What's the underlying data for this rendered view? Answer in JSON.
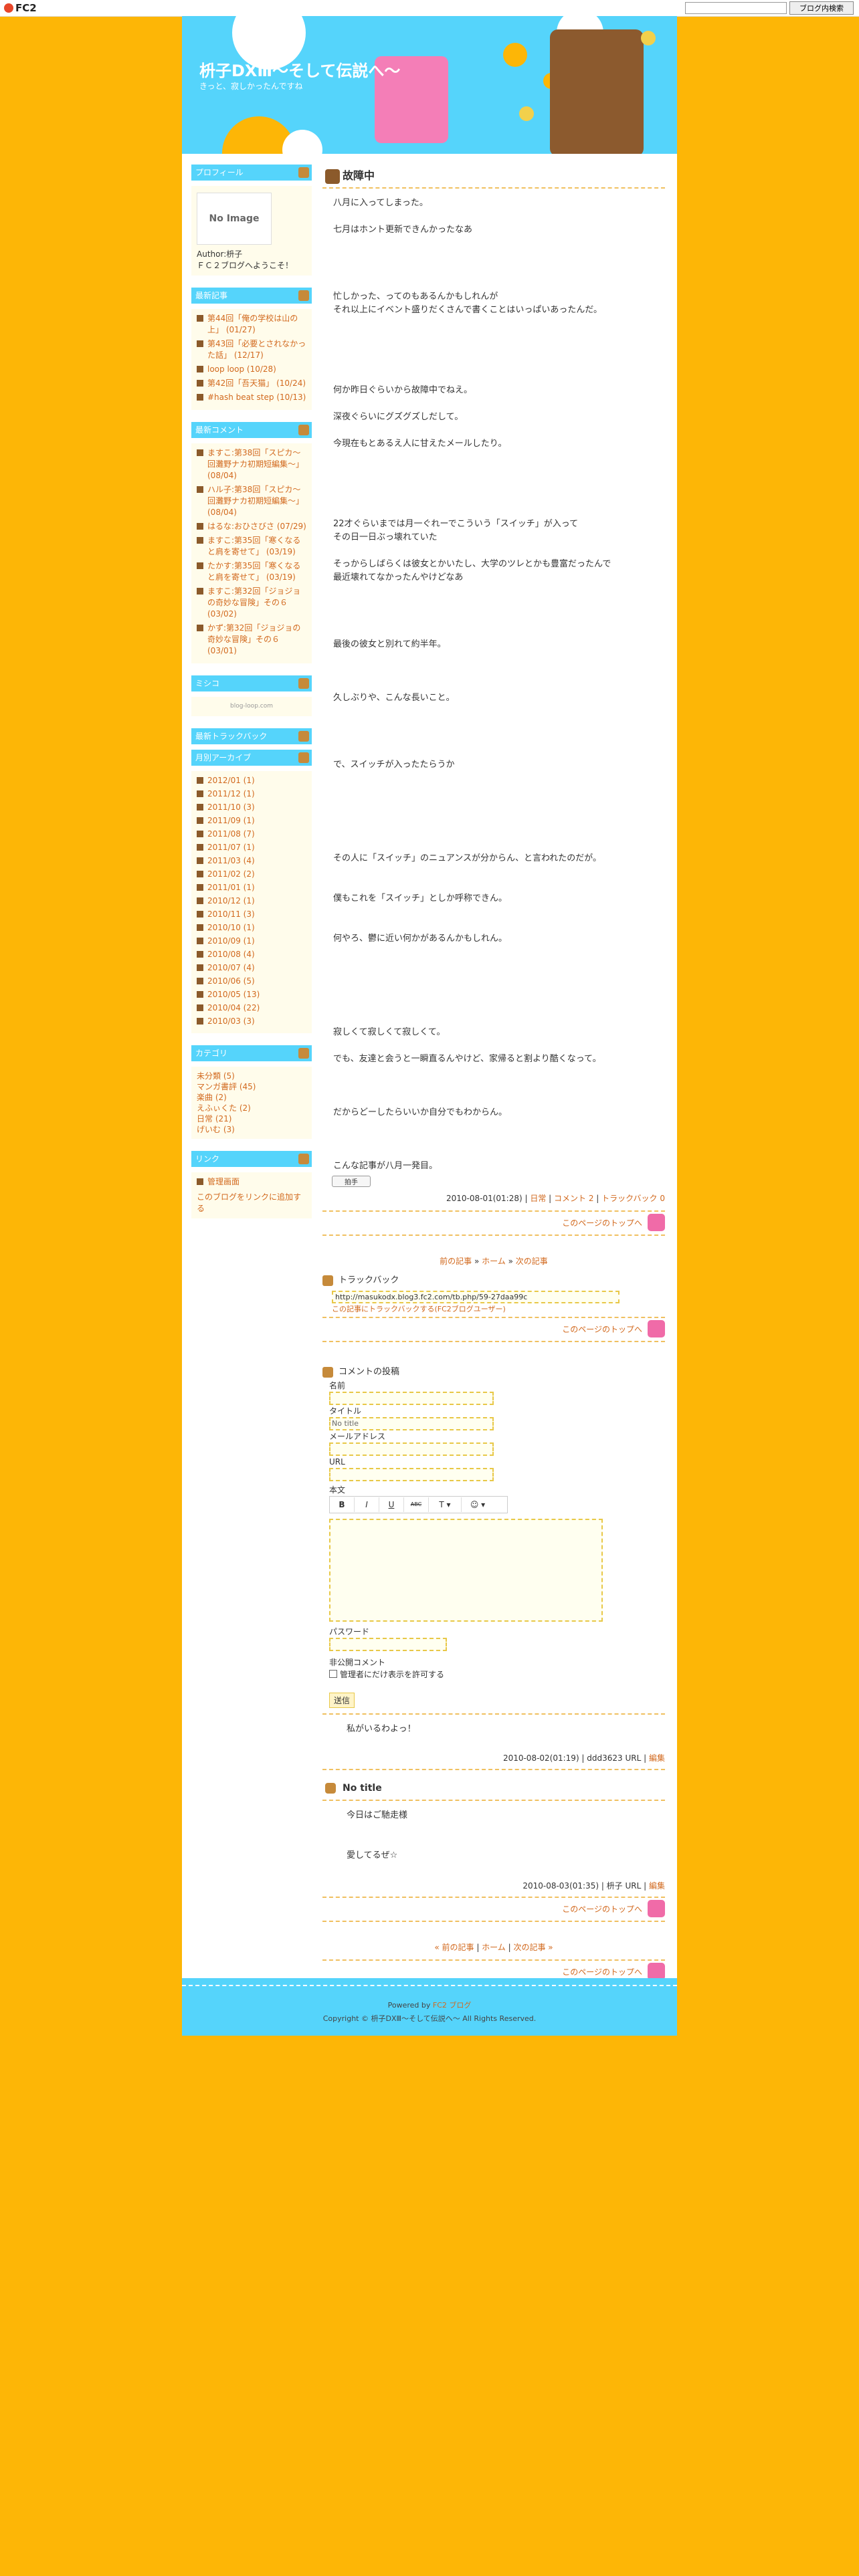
{
  "fc2bar": {
    "logo": "FC2",
    "search_value": "",
    "button": "ブログ内検索"
  },
  "header": {
    "title": "枡子DXⅢ〜そして伝説へ〜",
    "desc": "きっと、寂しかったんですね"
  },
  "sidebar": {
    "profile": {
      "title": "プロフィール",
      "noimage": "No Image",
      "author": "Author:枡子",
      "desc": "ＦＣ２ブログへようこそ！"
    },
    "recent": {
      "title": "最新記事",
      "items": [
        "第44回「俺の学校は山の上」 (01/27)",
        "第43回「必要とされなかった話」 (12/17)",
        "loop loop (10/28)",
        "第42回「吾天猫」 (10/24)",
        "#hash beat step (10/13)"
      ]
    },
    "comments": {
      "title": "最新コメント",
      "items": [
        "ますこ:第38回「スピカ〜回灘野ナカ初期短編集〜」 (08/04)",
        "ハル子:第38回「スピカ〜回灘野ナカ初期短編集〜」 (08/04)",
        "はるな:おひさびさ (07/29)",
        "ますこ:第35回「寒くなると肩を寄せて」 (03/19)",
        "たかす:第35回「寒くなると肩を寄せて」 (03/19)",
        "ますこ:第32回「ジョジョの奇妙な冒険」その６ (03/02)",
        "かず:第32回「ジョジョの奇妙な冒険」その６ (03/01)"
      ]
    },
    "misc": {
      "title": "ミシコ",
      "text": "blog-loop.com"
    },
    "trackback": {
      "title": "最新トラックバック"
    },
    "archive": {
      "title": "月別アーカイブ",
      "items": [
        "2012/01 (1)",
        "2011/12 (1)",
        "2011/10 (3)",
        "2011/09 (1)",
        "2011/08 (7)",
        "2011/07 (1)",
        "2011/03 (4)",
        "2011/02 (2)",
        "2011/01 (1)",
        "2010/12 (1)",
        "2010/11 (3)",
        "2010/10 (1)",
        "2010/09 (1)",
        "2010/08 (4)",
        "2010/07 (4)",
        "2010/06 (5)",
        "2010/05 (13)",
        "2010/04 (22)",
        "2010/03 (3)"
      ]
    },
    "category": {
      "title": "カテゴリ",
      "items": [
        "未分類 (5)",
        "マンガ書評 (45)",
        "楽曲 (2)",
        "えふぃくた (2)",
        "日常 (21)",
        "げいむ (3)"
      ]
    },
    "links": {
      "title": "リンク",
      "admin": "管理画面",
      "add": "このブログをリンクに追加する"
    }
  },
  "entry": {
    "title": "故障中",
    "paragraphs": [
      "八月に入ってしまった。",
      "",
      "七月はホント更新できんかったなあ",
      "",
      "",
      "",
      "",
      "忙しかった、ってのもあるんかもしれんが",
      "それ以上にイベント盛りだくさんで書くことはいっぱいあったんだ。",
      "",
      "",
      "",
      "",
      "",
      "何か昨日ぐらいから故障中でねえ。",
      "",
      "深夜ぐらいにグズグズしだして。",
      "",
      "今現在もとあるえ人に甘えたメールしたり。",
      "",
      "",
      "",
      "",
      "",
      "22才ぐらいまでは月一ぐれーでこういう「スイッチ」が入って",
      "その日一日ぶっ壊れていた",
      "",
      "そっからしばらくは彼女とかいたし、大学のツレとかも豊富だったんで",
      "最近壊れてなかったんやけどなあ",
      "",
      "",
      "",
      "",
      "最後の彼女と別れて約半年。",
      "",
      "",
      "",
      "久しぶりや、こんな長いこと。",
      "",
      "",
      "",
      "",
      "で、スイッチが入ったたらうか",
      "",
      "",
      "",
      "",
      "",
      "",
      "その人に「スイッチ」のニュアンスが分からん、と言われたのだが。",
      "",
      "",
      "僕もこれを「スイッチ」としか呼称できん。",
      "",
      "",
      "何やろ、鬱に近い何かがあるんかもしれん。",
      "",
      "",
      "",
      "",
      "",
      "",
      "寂しくて寂しくて寂しくて。",
      "",
      "でも、友達と会うと一瞬直るんやけど、家帰ると割より酷くなって。",
      "",
      "",
      "",
      "だからどーしたらいいか自分でもわからん。",
      "",
      "",
      "",
      "こんな記事が八月一発目。"
    ],
    "clap": "拍手",
    "footer": {
      "date": "2010-08-01(01:28)",
      "sep1": " | ",
      "category": "日常",
      "sep2": " | ",
      "comments": "コメント 2",
      "sep3": " | ",
      "trackback": "トラックバック 0"
    },
    "totop": "このページのトップへ"
  },
  "nav1": {
    "prev": "前の記事",
    "home": "ホーム",
    "next": "次の記事"
  },
  "trackback": {
    "title": "トラックバック",
    "url": "http://masukodx.blog3.fc2.com/tb.php/59-27daa99c",
    "link": "この記事にトラックバックする(FC2ブログユーザー)"
  },
  "comment_form": {
    "title": "コメントの投稿",
    "name_label": "名前",
    "title_label": "タイトル",
    "title_value": "No title",
    "mail_label": "メールアドレス",
    "url_label": "URL",
    "body_label": "本文",
    "tb_bold": "B",
    "tb_italic": "I",
    "tb_under": "U",
    "tb_strike": "ABC",
    "tb_text": "T ▾",
    "tb_link": "☺ ▾",
    "pass_label": "パスワード",
    "secret_label": "非公開コメント",
    "secret_check": "管理者にだけ表示を許可する",
    "submit": "送信"
  },
  "comments": [
    {
      "title": "",
      "body": [
        "私がいるわよっ！"
      ],
      "footer": "2010-08-02(01:19) | ddd3623 URL | ",
      "edit": "編集"
    },
    {
      "title": "No title",
      "body": [
        "今日はご馳走様",
        "",
        "",
        "愛してるぜ☆"
      ],
      "footer": "2010-08-03(01:35) | 枡子 URL | ",
      "edit": "編集"
    }
  ],
  "nav2": {
    "prev": "« 前の記事",
    "home": "ホーム",
    "next": "次の記事 »"
  },
  "footer": {
    "powered": "Powered by ",
    "powered_link": "FC2 ブログ",
    "copyright": "Copyright © 枡子DXⅢ〜そして伝説へ〜 All Rights Reserved."
  },
  "colors": {
    "bg": "#FDB606",
    "accent": "#55D4FB",
    "link": "#D2691E"
  }
}
